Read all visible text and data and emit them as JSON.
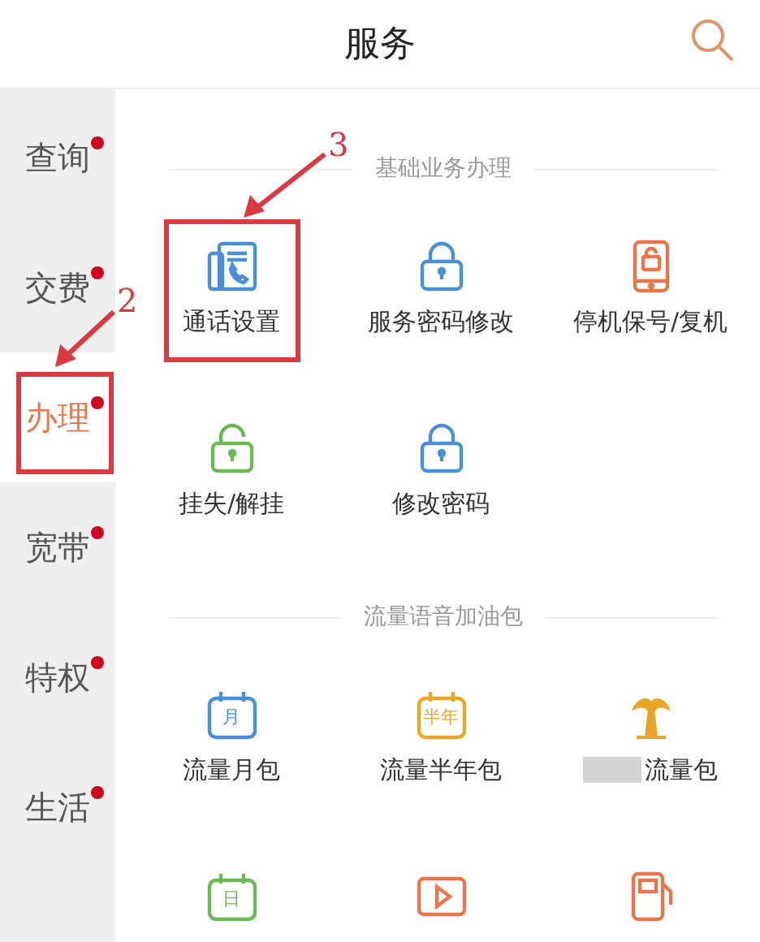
{
  "header": {
    "title": "服务"
  },
  "sidebar": {
    "items": [
      {
        "label": "查询",
        "selected": false,
        "badge": true,
        "highlighted": false
      },
      {
        "label": "交费",
        "selected": false,
        "badge": true,
        "highlighted": false
      },
      {
        "label": "办理",
        "selected": true,
        "badge": true,
        "highlighted": true
      },
      {
        "label": "宽带",
        "selected": false,
        "badge": true,
        "highlighted": false
      },
      {
        "label": "特权",
        "selected": false,
        "badge": true,
        "highlighted": false
      },
      {
        "label": "生活",
        "selected": false,
        "badge": true,
        "highlighted": false
      }
    ]
  },
  "sections": [
    {
      "title": "基础业务办理",
      "items": [
        {
          "label": "通话设置",
          "kind": "calldoc",
          "color": "#4a90d9",
          "highlighted": true
        },
        {
          "label": "服务密码修改",
          "kind": "lock",
          "color": "#4a90d9",
          "highlighted": false
        },
        {
          "label": "停机保号/复机",
          "kind": "phonelock",
          "color": "#e8764a",
          "highlighted": false
        },
        {
          "label": "挂失/解挂",
          "kind": "unlock",
          "color": "#6cb852",
          "highlighted": false
        },
        {
          "label": "修改密码",
          "kind": "lock",
          "color": "#4a90d9",
          "highlighted": false
        }
      ]
    },
    {
      "title": "流量语音加油包",
      "items": [
        {
          "label": "流量月包",
          "kind": "calendar",
          "icon_text": "月",
          "color": "#4a90d9",
          "highlighted": false
        },
        {
          "label": "流量半年包",
          "kind": "calendar",
          "icon_text": "半年",
          "color": "#e8a628",
          "highlighted": false
        },
        {
          "label": "流量包",
          "kind": "palm",
          "color": "#e8a628",
          "highlighted": false,
          "redacted_prefix": true
        },
        {
          "kind": "calendar",
          "icon_text": "日",
          "color": "#6cb852",
          "highlighted": false
        },
        {
          "kind": "play",
          "color": "#e8764a",
          "highlighted": false
        },
        {
          "kind": "fuel",
          "color": "#e8764a",
          "highlighted": false
        }
      ]
    }
  ],
  "annotations": [
    {
      "label": "3"
    },
    {
      "label": "2"
    }
  ]
}
